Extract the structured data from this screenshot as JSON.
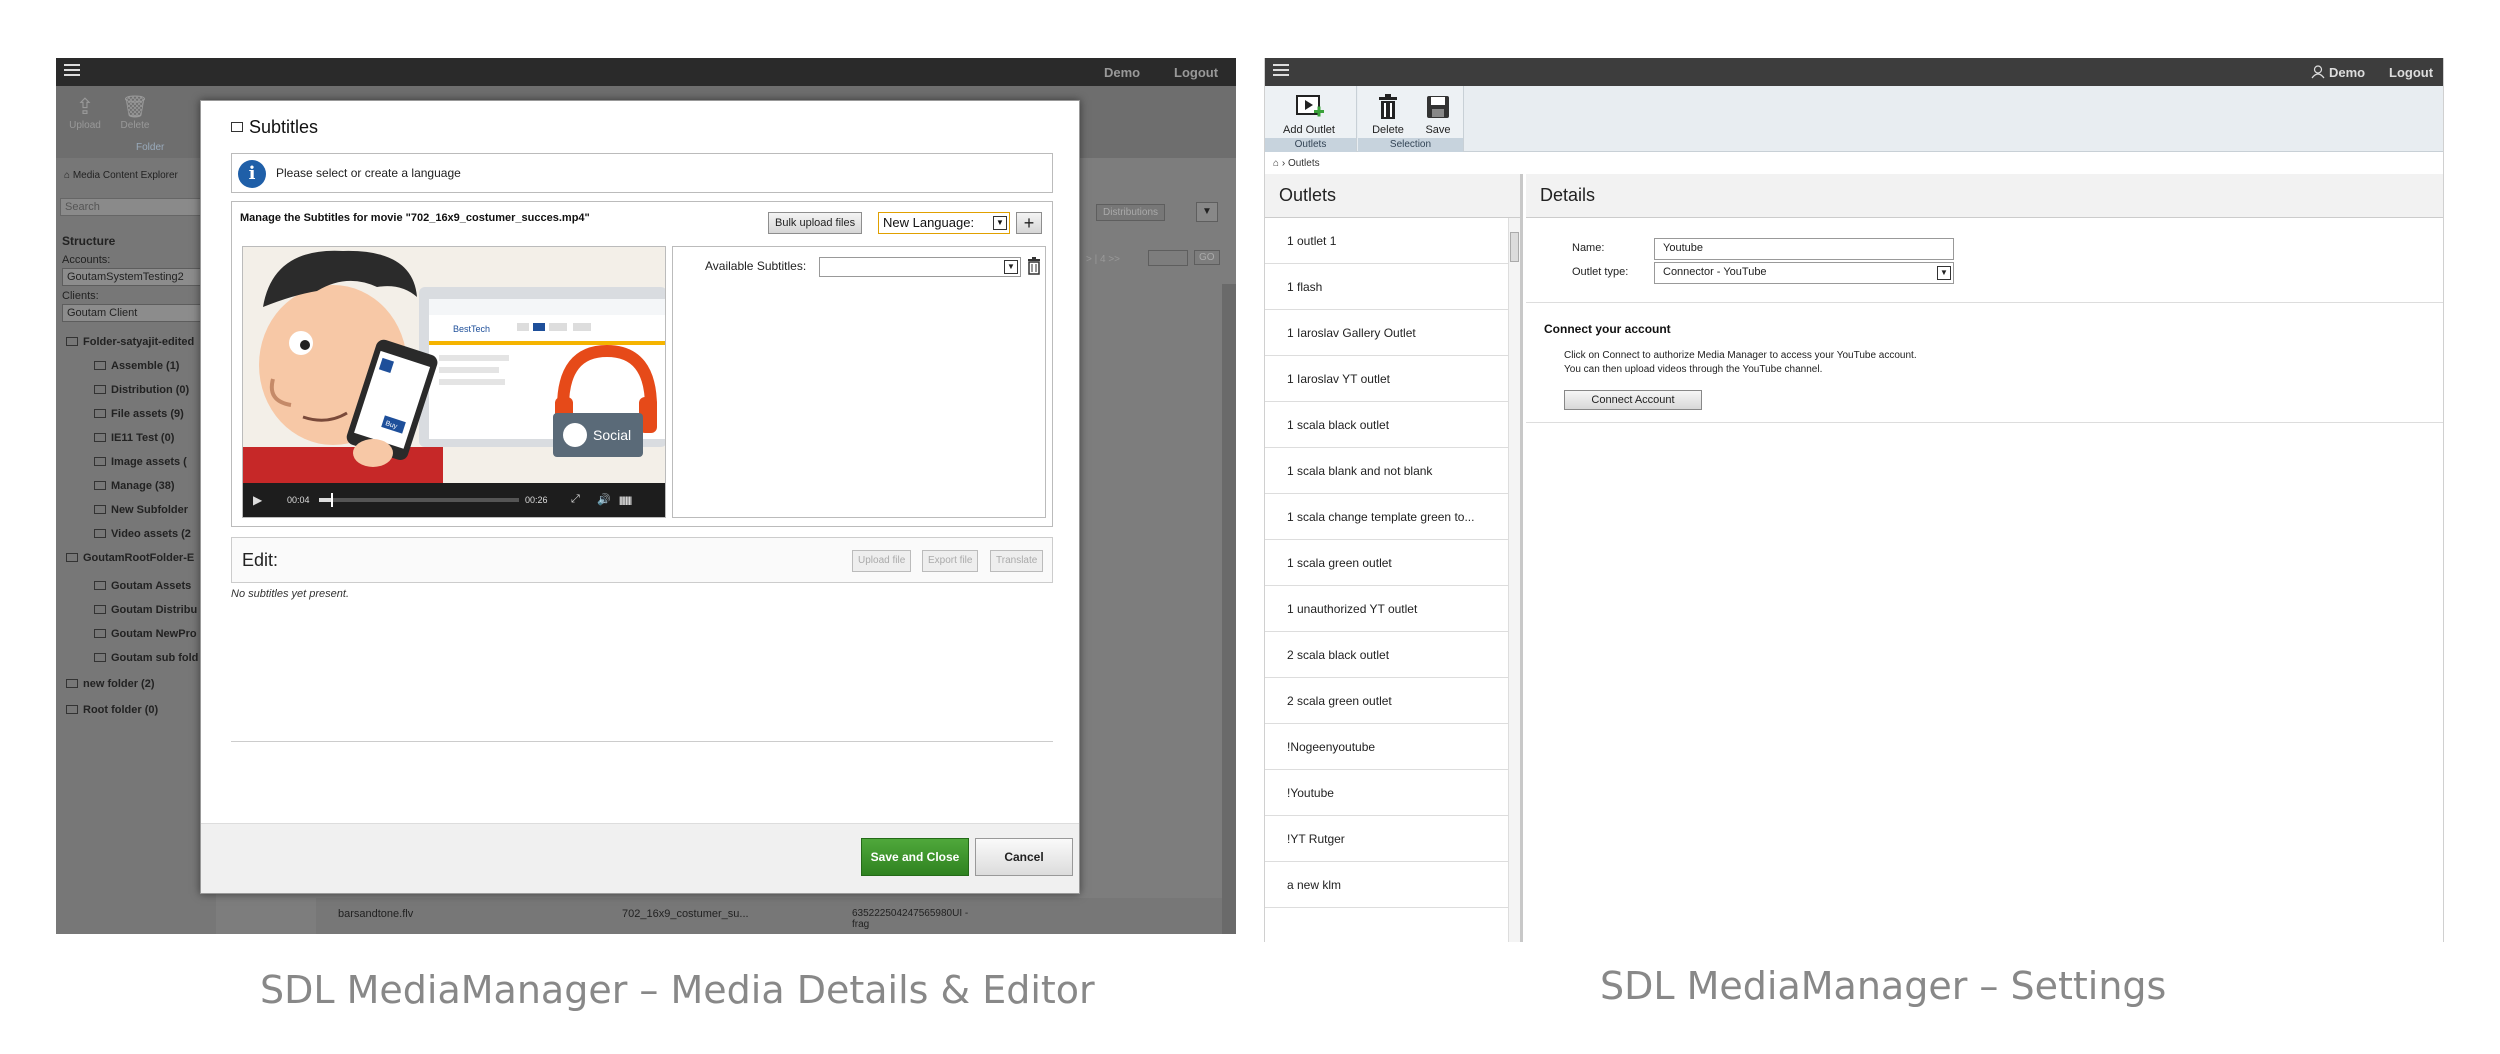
{
  "left": {
    "topbar": {
      "user": "Demo",
      "logout": "Logout"
    },
    "ribbon": {
      "upload": "Upload",
      "delete": "Delete",
      "group": "Folder"
    },
    "breadcrumb": "Media Content Explorer",
    "search_placeholder": "Search",
    "structure": "Structure",
    "accounts_label": "Accounts:",
    "account_value": "GoutamSystemTesting2",
    "clients_label": "Clients:",
    "client_value": "Goutam Client",
    "tree": [
      "Folder-satyajit-edited",
      "Assemble (1)",
      "Distribution (0)",
      "File assets (9)",
      "IE11 Test (0)",
      "Image assets (",
      "Manage (38)",
      "New Subfolder",
      "Video assets (2",
      "GoutamRootFolder-E",
      "Goutam Assets",
      "Goutam Distribu",
      "Goutam NewPro",
      "Goutam sub fold",
      "new folder (2)",
      "Root folder (0)"
    ],
    "right_controls": {
      "distributions": "Distributions",
      "pager": "> | 4 >>",
      "go": "GO"
    },
    "bottom_row": [
      "barsandtone.flv",
      "702_16x9_costumer_su...",
      "635222504247565980UI - frag"
    ],
    "modal": {
      "title": "Subtitles",
      "info": "Please select or create a language",
      "manage": "Manage the Subtitles for movie \"702_16x9_costumer_succes.mp4\"",
      "bulk_upload": "Bulk upload files",
      "new_language": "New Language:",
      "plus": "+",
      "available_subtitles": "Available Subtitles:",
      "video": {
        "time_current": "00:04",
        "time_total": "00:26",
        "brand": "BestTech",
        "social": "Social",
        "buy": "Buy",
        "progress": 0.06
      },
      "edit_label": "Edit:",
      "upload_file": "Upload file",
      "export_file": "Export file",
      "translate": "Translate",
      "no_subtitles": "No subtitles yet present.",
      "save_close": "Save and Close",
      "cancel": "Cancel"
    },
    "caption": "SDL MediaManager – Media Details & Editor"
  },
  "right": {
    "topbar": {
      "user": "Demo",
      "logout": "Logout"
    },
    "ribbon": {
      "add_outlet": "Add Outlet",
      "delete": "Delete",
      "save": "Save",
      "group_outlets": "Outlets",
      "group_selection": "Selection"
    },
    "breadcrumb": "Outlets",
    "outlets_header": "Outlets",
    "outlets": [
      "1 outlet 1",
      "1 flash",
      "1 Iaroslav Gallery Outlet",
      "1 Iaroslav YT outlet",
      "1 scala black outlet",
      "1 scala blank and not blank",
      "1 scala change template green to...",
      "1 scala green outlet",
      "1 unauthorized YT outlet",
      "2 scala black outlet",
      "2 scala green outlet",
      "!Nogeenyoutube",
      "!Youtube",
      "!YT Rutger",
      "a new klm"
    ],
    "details_header": "Details",
    "name_label": "Name:",
    "name_value": "Youtube",
    "type_label": "Outlet type:",
    "type_value": "Connector - YouTube",
    "connect_title": "Connect your account",
    "connect_line1": "Click on Connect to authorize Media Manager to access your YouTube account.",
    "connect_line2": "You can then upload videos through the YouTube channel.",
    "connect_button": "Connect Account",
    "caption": "SDL MediaManager – Settings"
  }
}
